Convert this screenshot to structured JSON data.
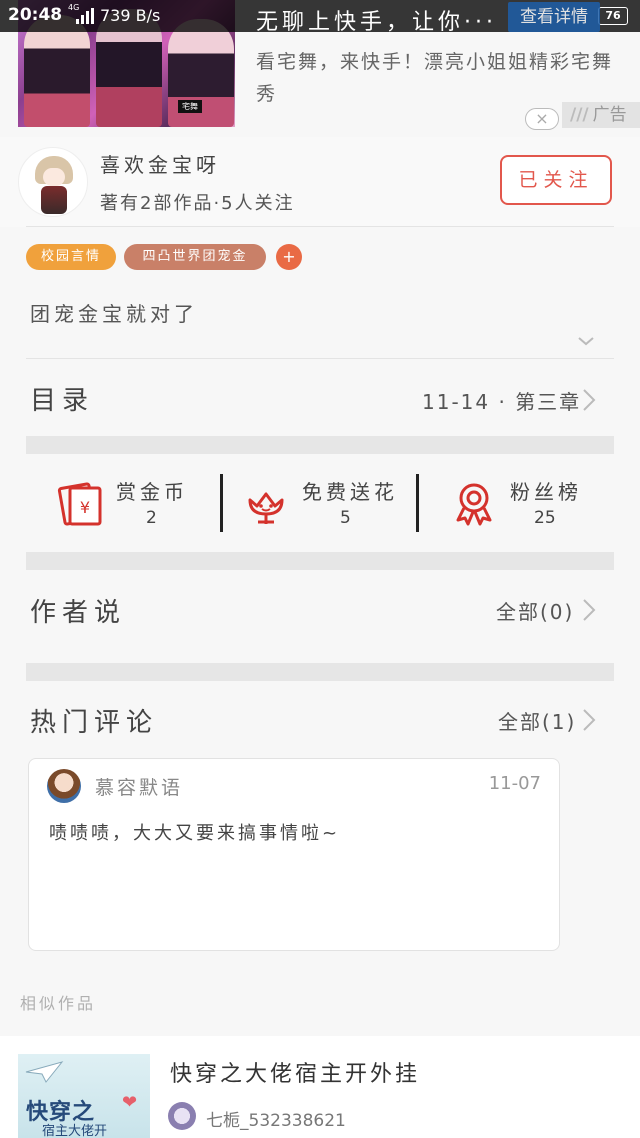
{
  "status_bar": {
    "time": "20:48",
    "network": "4G",
    "speed": "739 B/s",
    "battery": "76"
  },
  "ad": {
    "headline": "无聊上快手，让你···",
    "cta_label": "查看详情",
    "image_tag": "宅舞",
    "description": "看宅舞，来快手！漂亮小姐姐精彩宅舞秀",
    "close_glyph": "×",
    "label": "广告"
  },
  "author": {
    "name": "喜欢金宝呀",
    "stats": "著有2部作品·5人关注",
    "follow_label": "已关注"
  },
  "tags": {
    "items": [
      "校园言情",
      "四凸世界团宠金"
    ],
    "add_glyph": "+"
  },
  "synopsis": "团宠金宝就对了",
  "catalog": {
    "title": "目录",
    "latest": "11-14 · 第三章"
  },
  "stats": [
    {
      "label": "赏金币",
      "count": "2",
      "icon": "red-envelope-icon"
    },
    {
      "label": "免费送花",
      "count": "5",
      "icon": "flower-icon"
    },
    {
      "label": "粉丝榜",
      "count": "25",
      "icon": "medal-icon"
    }
  ],
  "author_says": {
    "title": "作者说",
    "count_label": "全部(0)"
  },
  "hot_comments": {
    "title": "热门评论",
    "count_label": "全部(1)",
    "items": [
      {
        "user": "慕容默语",
        "date": "11-07",
        "text": "啧啧啧，大大又要来搞事情啦~"
      }
    ]
  },
  "similar": {
    "label": "相似作品",
    "items": [
      {
        "title": "快穿之大佬宿主开外挂",
        "author": "七栀_532338621",
        "cover_title": "快穿之",
        "cover_sub": "宿主大佬开"
      }
    ]
  },
  "colors": {
    "accent": "#e2574c",
    "tag1": "#f0a13c",
    "tag2": "#c98068",
    "icon_red": "#d4322c"
  }
}
